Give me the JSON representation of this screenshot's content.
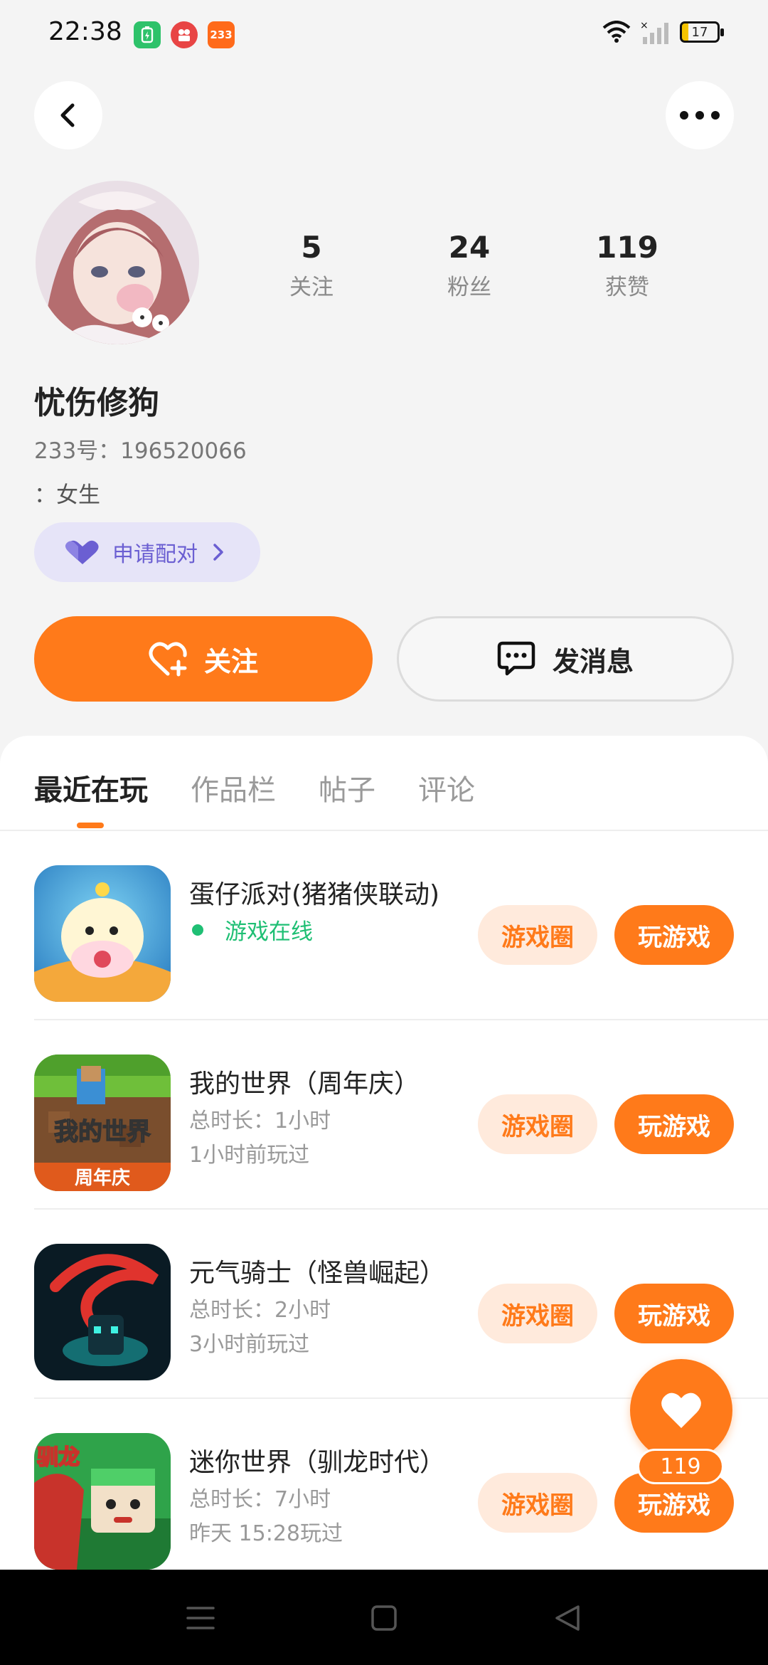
{
  "status_bar": {
    "time": "22:38",
    "app_icons": [
      "battery-saver-icon",
      "video-app-icon",
      "233-app-icon"
    ],
    "app3_label": "233",
    "battery_level": "17"
  },
  "header": {
    "back_icon": "chevron-left-icon",
    "more_icon": "more-dots-icon"
  },
  "profile": {
    "stats": [
      {
        "value": "5",
        "label": "关注"
      },
      {
        "value": "24",
        "label": "粉丝"
      },
      {
        "value": "119",
        "label": "获赞"
      }
    ],
    "nickname": "忧伤修狗",
    "uid_line": "233号：196520066",
    "gender_line": "：女生",
    "pair_label": "申请配对",
    "follow_label": "关注",
    "message_label": "发消息"
  },
  "tabs": [
    "最近在玩",
    "作品栏",
    "帖子",
    "评论"
  ],
  "active_tab": 0,
  "games": [
    {
      "title": "蛋仔派对(猪猪侠联动)",
      "status": "游戏在线",
      "circle_label": "游戏圈",
      "play_label": "玩游戏"
    },
    {
      "title": "我的世界（周年庆）",
      "duration": "总时长：1小时",
      "last_played": "1小时前玩过",
      "circle_label": "游戏圈",
      "play_label": "玩游戏",
      "icon_text_top": "我的世界",
      "icon_text_bottom": "周年庆"
    },
    {
      "title": "元气骑士（怪兽崛起）",
      "duration": "总时长：2小时",
      "last_played": "3小时前玩过",
      "circle_label": "游戏圈",
      "play_label": "玩游戏"
    },
    {
      "title": "迷你世界（驯龙时代）",
      "duration": "总时长：7小时",
      "last_played": "昨天 15:28玩过",
      "circle_label": "游戏圈",
      "play_label": "玩游戏",
      "icon_text": "驯龙"
    }
  ],
  "like_fab": {
    "count": "119"
  },
  "colors": {
    "accent": "#ff7a1a",
    "online": "#1fbf74",
    "pair": "#6b5fd2"
  }
}
